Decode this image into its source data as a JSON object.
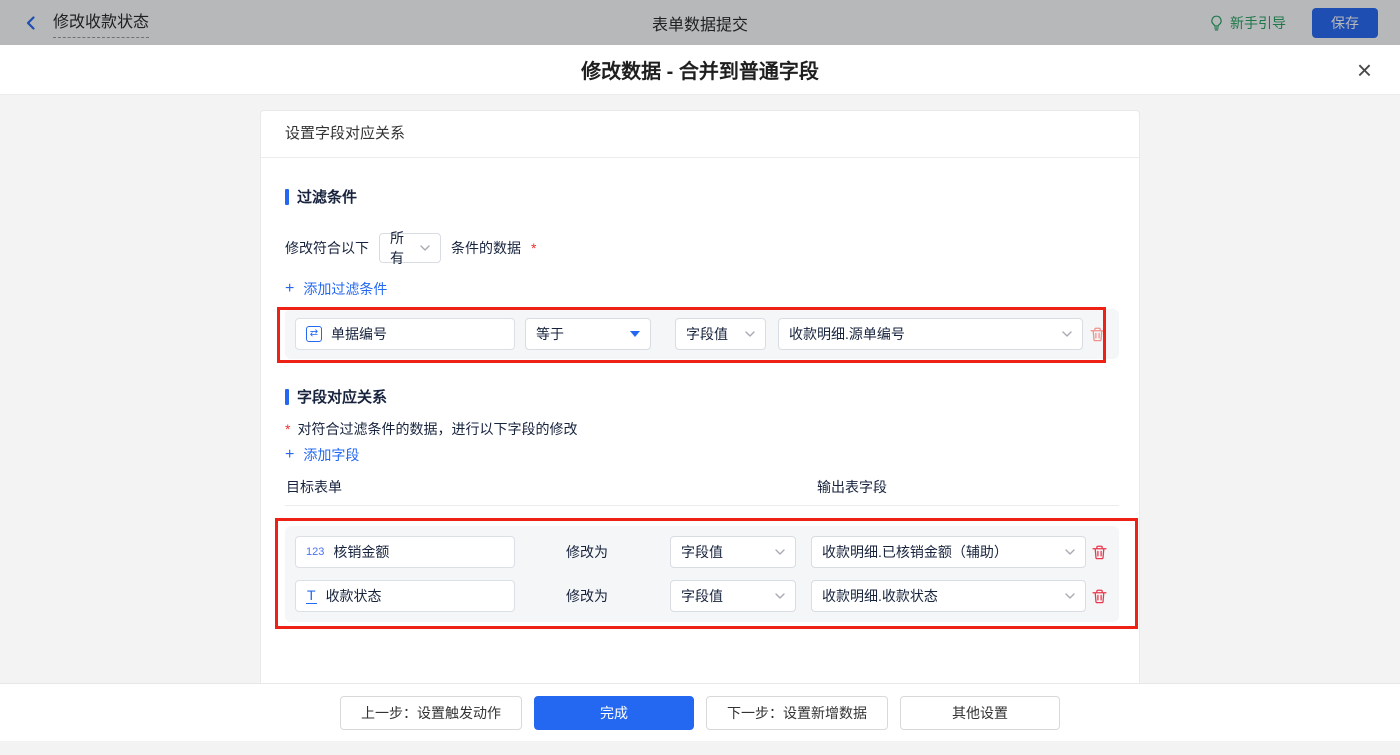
{
  "topbar": {
    "flow_name": "修改收款状态",
    "page_title": "表单数据提交",
    "guide_label": "新手引导",
    "save_label": "保存"
  },
  "modal": {
    "title": "修改数据 - 合并到普通字段",
    "close_glyph": "×"
  },
  "panel": {
    "header": "设置字段对应关系",
    "filter": {
      "title": "过滤条件",
      "prefix": "修改符合以下",
      "match_value": "所有",
      "suffix": "条件的数据",
      "required_mark": "*",
      "add_plus": "+",
      "add_label": "添加过滤条件",
      "row": {
        "field_icon_glyph": "⇄",
        "field": "单据编号",
        "operator": "等于",
        "value_type": "字段值",
        "value": "收款明细.源单编号"
      }
    },
    "mapping": {
      "title": "字段对应关系",
      "required_mark": "*",
      "description": "对符合过滤条件的数据，进行以下字段的修改",
      "add_plus": "+",
      "add_label": "添加字段",
      "col_target": "目标表单",
      "col_output": "输出表字段",
      "modify_label": "修改为",
      "rows": [
        {
          "icon_glyph": "123",
          "field": "核销金额",
          "value_type": "字段值",
          "value": "收款明细.已核销金额（辅助）"
        },
        {
          "icon_glyph": "T",
          "field": "收款状态",
          "value_type": "字段值",
          "value": "收款明细.收款状态"
        }
      ]
    }
  },
  "footer": {
    "prev_label": "上一步：设置触发动作",
    "done_label": "完成",
    "next_label": "下一步：设置新增数据",
    "other_label": "其他设置"
  },
  "colors": {
    "accent_blue": "#2468f2",
    "annotation_red": "#ee2116",
    "danger_red": "#e8384d",
    "guide_green": "#26a35f"
  }
}
